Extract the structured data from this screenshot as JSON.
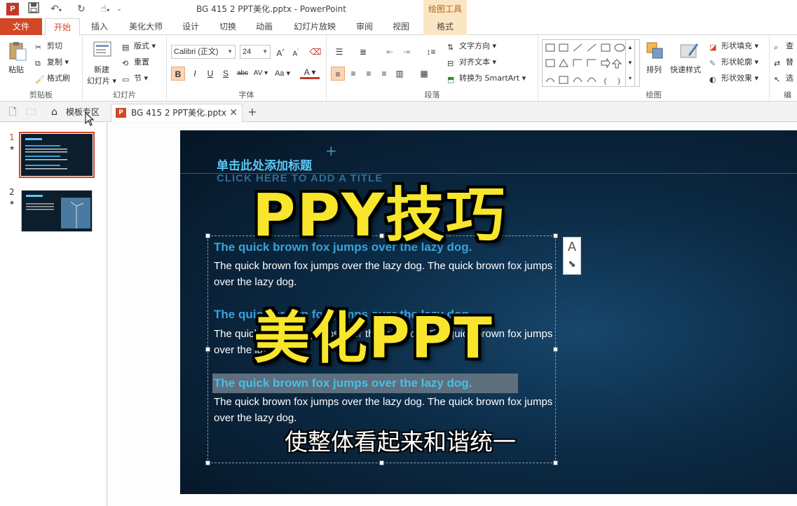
{
  "window": {
    "title": "BG 415 2 PPT美化.pptx - PowerPoint",
    "app_icon_letter": "P",
    "contextual_tab_group": "绘图工具"
  },
  "tabs": [
    "文件",
    "开始",
    "插入",
    "美化大师",
    "设计",
    "切换",
    "动画",
    "幻灯片放映",
    "审阅",
    "视图",
    "格式"
  ],
  "ribbon": {
    "clipboard": {
      "label": "剪贴板",
      "paste": "粘贴",
      "cut": "剪切",
      "copy": "复制",
      "format_painter": "格式刷"
    },
    "slides": {
      "label": "幻灯片",
      "new_slide_line1": "新建",
      "new_slide_line2": "幻灯片",
      "layout": "版式",
      "reset": "重置",
      "section": "节"
    },
    "font": {
      "label": "字体",
      "font_name": "Calibri (正文)",
      "font_size": "24",
      "bold": "B",
      "italic": "I",
      "underline": "U",
      "shadow": "S",
      "strike": "abc",
      "spacing": "AV",
      "case": "Aa",
      "font_color": "A",
      "grow": "A",
      "shrink": "A"
    },
    "paragraph": {
      "label": "段落",
      "text_direction": "文字方向",
      "align_text": "对齐文本",
      "convert_smartart": "转换为 SmartArt"
    },
    "drawing": {
      "label": "绘图",
      "arrange": "排列",
      "quick_styles": "快速样式",
      "shape_fill": "形状填充",
      "shape_outline": "形状轮廓",
      "shape_effects": "形状效果"
    },
    "editing": {
      "label": "编",
      "find": "查",
      "replace": "替",
      "select": "选"
    }
  },
  "doc_tabs": {
    "template_area": "模板专区",
    "file_tab": "BG 415 2 PPT美化.pptx"
  },
  "thumbnails": [
    {
      "number": "1",
      "star": "★"
    },
    {
      "number": "2",
      "star": "★"
    }
  ],
  "slide": {
    "title_placeholder": "单击此处添加标题",
    "title_sub": "CLICK HERE TO ADD A TITLE",
    "paragraphs": [
      {
        "head": "The quick brown fox jumps over the lazy dog.",
        "body": " The quick brown fox jumps over the lazy dog. The quick brown fox jumps over the lazy dog."
      },
      {
        "head": "The quick brown fox jumps over the lazy dog.",
        "body": "The quick brown fox jumps over the lazy dog. The quick brown fox jumps over the lazy dog."
      },
      {
        "head": "The quick brown fox jumps over the lazy dog.",
        "body": "The quick brown fox jumps over the lazy dog. The quick brown fox jumps over the lazy dog."
      }
    ],
    "float_icon_letter": "A"
  },
  "overlay": {
    "title": "PPY技巧",
    "subtitle": "美化PPT",
    "caption": "使整体看起来和谐统一"
  },
  "colors": {
    "file_tab": "#d24726",
    "overlay_yellow": "#f7e62c",
    "slide_heading": "#3aa3d8"
  }
}
